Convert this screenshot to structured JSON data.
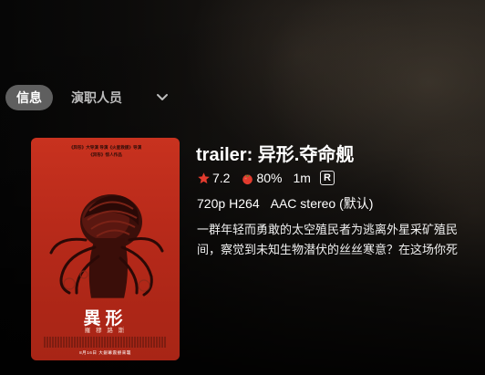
{
  "tabs": [
    {
      "label": "信息",
      "active": true
    },
    {
      "label": "演职人员",
      "active": false
    }
  ],
  "poster": {
    "credit_line1": "《异形》大导演 导演《火星救援》导演",
    "credit_line2": "《异形》惊人作品",
    "title": "異形",
    "subtitle": "羅 穆 路 斯",
    "date_line": "8月16日 大銀幕震撼來襲"
  },
  "title": "trailer: 异形.夺命舰",
  "ratings": {
    "star_score": "7.2",
    "tomato_score": "80%",
    "runtime": "1m",
    "rated": "R"
  },
  "media": {
    "resolution": "720p",
    "codec": "H264",
    "audio": "AAC stereo (默认)"
  },
  "overview": {
    "line1": "一群年轻而勇敢的太空殖民者为逃离外星采矿殖民",
    "line2": "间，察觉到未知生物潜伏的丝丝寒意？在这场你死"
  },
  "colors": {
    "star": "#e23b2e",
    "tomato": "#e23b2e",
    "tab_active_bg": "#5f5f5f",
    "poster_bg": "#c02e1c"
  },
  "icons": {
    "more": "chevron-down-icon",
    "star": "star-icon",
    "tomato": "tomato-icon"
  }
}
